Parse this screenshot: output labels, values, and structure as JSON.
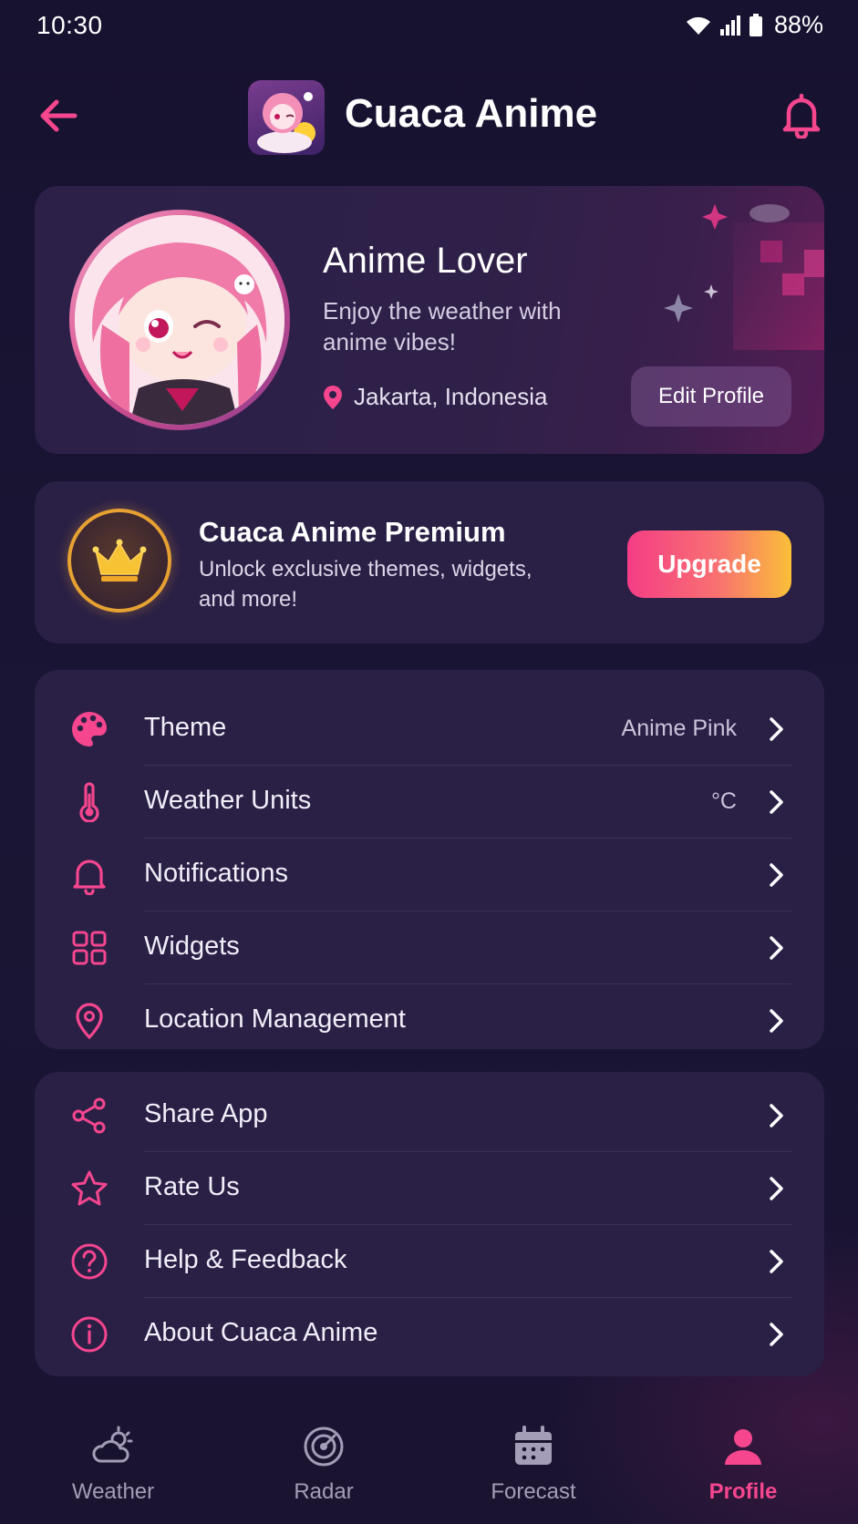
{
  "status_bar": {
    "time": "10:30",
    "battery": "88%",
    "icons": [
      "wifi-icon",
      "signal-icon",
      "battery-icon"
    ]
  },
  "header": {
    "title": "Cuaca Anime",
    "back_icon": "arrow-left-icon",
    "notification_icon": "bell-icon"
  },
  "profile": {
    "name": "Anime Lover",
    "tagline": "Enjoy the weather with anime vibes!",
    "location": "Jakarta, Indonesia",
    "edit_label": "Edit Profile"
  },
  "premium": {
    "title": "Cuaca Anime Premium",
    "description": "Unlock exclusive themes, widgets, and more!",
    "upgrade_label": "Upgrade"
  },
  "settings": {
    "items": [
      {
        "label": "Theme",
        "value": "Anime Pink",
        "icon": "palette-icon"
      },
      {
        "label": "Weather Units",
        "value": "°C",
        "icon": "thermometer-icon"
      },
      {
        "label": "Notifications",
        "value": "",
        "icon": "bell-icon"
      },
      {
        "label": "Widgets",
        "value": "",
        "icon": "widgets-grid-icon"
      },
      {
        "label": "Location Management",
        "value": "",
        "icon": "location-pin-icon"
      }
    ]
  },
  "more": {
    "items": [
      {
        "label": "Share App",
        "icon": "share-icon"
      },
      {
        "label": "Rate Us",
        "icon": "star-icon"
      },
      {
        "label": "Help & Feedback",
        "icon": "help-circle-icon"
      },
      {
        "label": "About Cuaca Anime",
        "icon": "info-circle-icon"
      }
    ]
  },
  "bottom_nav": {
    "items": [
      {
        "label": "Weather",
        "icon": "weather-cloud-icon",
        "active": false
      },
      {
        "label": "Radar",
        "icon": "radar-icon",
        "active": false
      },
      {
        "label": "Forecast",
        "icon": "calendar-icon",
        "active": false
      },
      {
        "label": "Profile",
        "icon": "user-icon",
        "active": true
      }
    ]
  },
  "colors": {
    "accent": "#f5468e",
    "background": "#17122d",
    "card": "#2a2046",
    "premium_gold": "#e7a132"
  }
}
